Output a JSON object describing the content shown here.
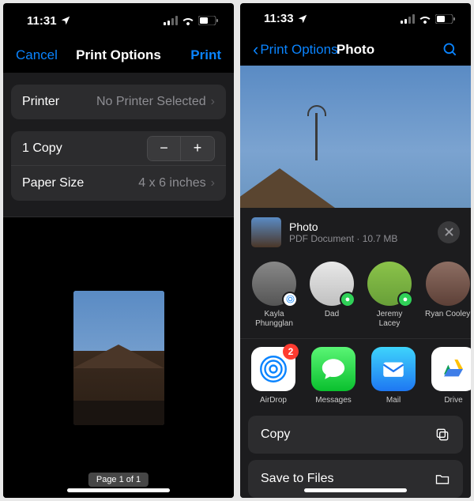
{
  "left": {
    "status": {
      "time": "11:31",
      "loc": true
    },
    "nav": {
      "cancel": "Cancel",
      "title": "Print Options",
      "print": "Print"
    },
    "printer": {
      "label": "Printer",
      "value": "No Printer Selected"
    },
    "copies": {
      "label": "1 Copy"
    },
    "paper": {
      "label": "Paper Size",
      "value": "4 x 6 inches"
    },
    "page_label": "Page 1 of 1"
  },
  "right": {
    "status": {
      "time": "11:33",
      "loc": true
    },
    "nav": {
      "back": "Print Options",
      "title": "Photo"
    },
    "file": {
      "name": "Photo",
      "meta": "PDF Document · 10.7 MB"
    },
    "contacts": [
      {
        "name": "Kayla Phungglan"
      },
      {
        "name": "Dad"
      },
      {
        "name": "Jeremy Lacey"
      },
      {
        "name": "Ryan Cooley"
      }
    ],
    "apps": [
      {
        "name": "AirDrop",
        "badge": "2"
      },
      {
        "name": "Messages"
      },
      {
        "name": "Mail"
      },
      {
        "name": "Drive"
      }
    ],
    "actions": {
      "copy": "Copy",
      "save": "Save to Files"
    }
  }
}
